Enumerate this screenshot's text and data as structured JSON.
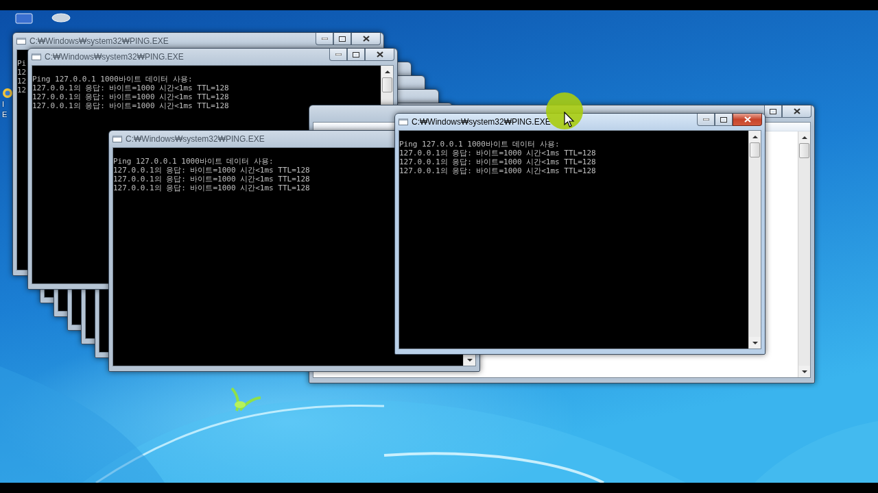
{
  "desktop": {
    "icons": [
      {
        "label_lines": [
          "I",
          "E"
        ]
      }
    ]
  },
  "windows": [
    {
      "kind": "console",
      "title": "C:₩Windows₩system32₩PING.EXE",
      "active": false,
      "lines": [
        "Pi",
        "12",
        "12",
        "12"
      ]
    },
    {
      "kind": "console",
      "active": false
    },
    {
      "kind": "console",
      "active": false
    },
    {
      "kind": "console",
      "active": false
    },
    {
      "kind": "console",
      "active": false
    },
    {
      "kind": "console",
      "active": false
    },
    {
      "kind": "console",
      "title": "C:₩Windows₩system32₩PING.EXE",
      "active": false,
      "lines": [
        "Ping 127.0.0.1 1000바이트 데이터 사용:",
        "127.0.0.1의 응답: 바이트=1000 시간<1ms TTL=128",
        "127.0.0.1의 응답: 바이트=1000 시간<1ms TTL=128",
        "127.0.0.1의 응답: 바이트=1000 시간<1ms TTL=128"
      ]
    },
    {
      "kind": "explorer",
      "active": false
    },
    {
      "kind": "console",
      "title": "C:₩Windows₩system32₩PING.EXE",
      "active": false,
      "lines": [
        "Ping 127.0.0.1 1000바이트 데이터 사용:",
        "127.0.0.1의 응답: 바이트=1000 시간<1ms TTL=128",
        "127.0.0.1의 응답: 바이트=1000 시간<1ms TTL=128",
        "127.0.0.1의 응답: 바이트=1000 시간<1ms TTL=128"
      ]
    },
    {
      "kind": "console",
      "title": "C:₩Windows₩system32₩PING.EXE",
      "active": true,
      "lines": [
        "Ping 127.0.0.1 1000바이트 데이터 사용:",
        "127.0.0.1의 응답: 바이트=1000 시간<1ms TTL=128",
        "127.0.0.1의 응답: 바이트=1000 시간<1ms TTL=128",
        "127.0.0.1의 응답: 바이트=1000 시간<1ms TTL=128"
      ]
    }
  ]
}
